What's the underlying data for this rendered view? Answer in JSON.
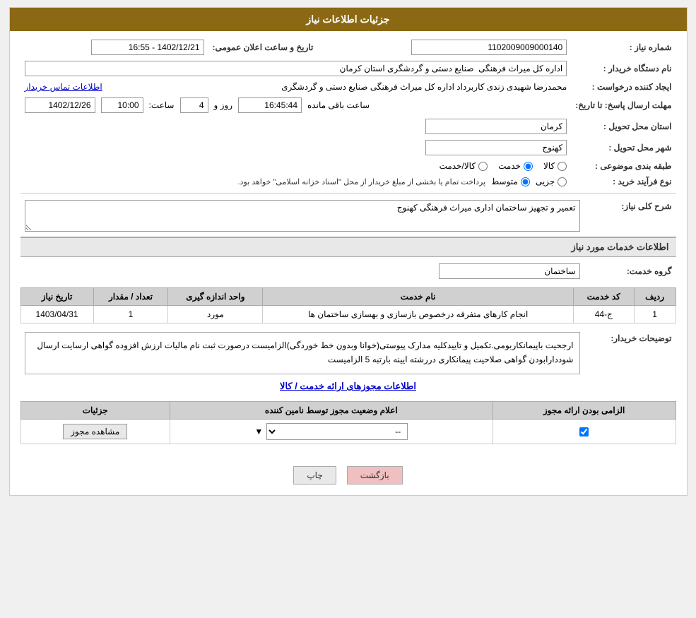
{
  "header": {
    "title": "جزئیات اطلاعات نیاز"
  },
  "info": {
    "need_number_label": "شماره نیاز :",
    "need_number_value": "1102009009000140",
    "date_label": "تاریخ و ساعت اعلان عمومی:",
    "date_value": "1402/12/21 - 16:55",
    "buyer_label": "نام دستگاه خریدار :",
    "buyer_value": "اداره کل میراث فرهنگی  صنایع دستی و گردشگری استان کرمان",
    "creator_label": "ایجاد کننده درخواست :",
    "creator_value": "محمدرضا شهیدی زندی کاربرداد اداره کل میراث فرهنگی  صنایع دستی و گردشگری",
    "contact_link": "اطلاعات تماس خریدار",
    "response_deadline_label": "مهلت ارسال پاسخ: تا تاریخ:",
    "response_date": "1402/12/26",
    "response_time_label": "ساعت:",
    "response_time": "10:00",
    "response_days_label": "روز و",
    "response_days": "4",
    "response_remaining_label": "ساعت باقی مانده",
    "response_remaining": "16:45:44",
    "province_label": "استان محل تحویل :",
    "province_value": "کرمان",
    "city_label": "شهر محل تحویل :",
    "city_value": "کهنوج",
    "category_label": "طبقه بندی موضوعی :",
    "category_options": [
      "کالا",
      "خدمت",
      "کالا/خدمت"
    ],
    "category_selected": "خدمت",
    "process_label": "نوع فرآیند خرید :",
    "process_options": [
      "جزیی",
      "متوسط"
    ],
    "process_selected": "متوسط",
    "process_note": "پرداخت تمام یا بخشی از مبلغ خریدار از محل \"اسناد خزانه اسلامی\" خواهد بود."
  },
  "need_description": {
    "section_title": "شرح کلی نیاز:",
    "value": "تعمیر و تجهیز ساختمان اداری میراث فرهنگی کهنوج"
  },
  "services_section": {
    "section_title": "اطلاعات خدمات مورد نیاز",
    "service_group_label": "گروه خدمت:",
    "service_group_value": "ساختمان",
    "table_headers": [
      "ردیف",
      "کد خدمت",
      "نام خدمت",
      "واحد اندازه گیری",
      "تعداد / مقدار",
      "تاریخ نیاز"
    ],
    "table_rows": [
      {
        "row": "1",
        "code": "ج-44",
        "name": "انجام کارهای متفرقه درخصوص بازسازی و بهسازی ساختمان ها",
        "unit": "مورد",
        "quantity": "1",
        "date": "1403/04/31"
      }
    ]
  },
  "buyer_notes": {
    "label": "توضیحات خریدار:",
    "text": "ارجحیت باپیمانکاربومی.تکمیل و تاییدکلیه مدارک پیوستی(خوانا وبدون خط خوردگی)الزامیست درصورت ثبت نام مالیات ارزش افزوده گواهی ارسایت ارسال شوددارابودن گواهی صلاحیت پیمانکاری دررشته ایینه بارتبه 5 الزامیست"
  },
  "permits_section": {
    "title_link": "اطلاعات مجوزهای ارائه خدمت / کالا",
    "table_headers": [
      "الزامی بودن ارائه مجوز",
      "اعلام وضعیت مجوز توسط نامین کننده",
      "جزئیات"
    ],
    "table_rows": [
      {
        "required": true,
        "status": "--",
        "details_label": "مشاهده مجوز"
      }
    ]
  },
  "buttons": {
    "back_label": "بازگشت",
    "print_label": "چاپ"
  }
}
